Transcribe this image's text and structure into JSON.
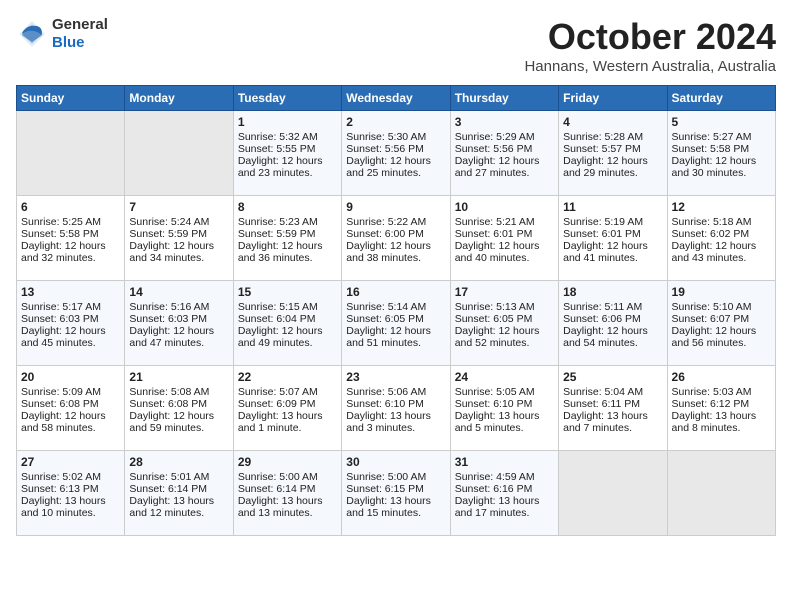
{
  "header": {
    "logo_line1": "General",
    "logo_line2": "Blue",
    "month_title": "October 2024",
    "location": "Hannans, Western Australia, Australia"
  },
  "weekdays": [
    "Sunday",
    "Monday",
    "Tuesday",
    "Wednesday",
    "Thursday",
    "Friday",
    "Saturday"
  ],
  "weeks": [
    [
      {
        "day": "",
        "info": ""
      },
      {
        "day": "",
        "info": ""
      },
      {
        "day": "1",
        "info": "Sunrise: 5:32 AM\nSunset: 5:55 PM\nDaylight: 12 hours and 23 minutes."
      },
      {
        "day": "2",
        "info": "Sunrise: 5:30 AM\nSunset: 5:56 PM\nDaylight: 12 hours and 25 minutes."
      },
      {
        "day": "3",
        "info": "Sunrise: 5:29 AM\nSunset: 5:56 PM\nDaylight: 12 hours and 27 minutes."
      },
      {
        "day": "4",
        "info": "Sunrise: 5:28 AM\nSunset: 5:57 PM\nDaylight: 12 hours and 29 minutes."
      },
      {
        "day": "5",
        "info": "Sunrise: 5:27 AM\nSunset: 5:58 PM\nDaylight: 12 hours and 30 minutes."
      }
    ],
    [
      {
        "day": "6",
        "info": "Sunrise: 5:25 AM\nSunset: 5:58 PM\nDaylight: 12 hours and 32 minutes."
      },
      {
        "day": "7",
        "info": "Sunrise: 5:24 AM\nSunset: 5:59 PM\nDaylight: 12 hours and 34 minutes."
      },
      {
        "day": "8",
        "info": "Sunrise: 5:23 AM\nSunset: 5:59 PM\nDaylight: 12 hours and 36 minutes."
      },
      {
        "day": "9",
        "info": "Sunrise: 5:22 AM\nSunset: 6:00 PM\nDaylight: 12 hours and 38 minutes."
      },
      {
        "day": "10",
        "info": "Sunrise: 5:21 AM\nSunset: 6:01 PM\nDaylight: 12 hours and 40 minutes."
      },
      {
        "day": "11",
        "info": "Sunrise: 5:19 AM\nSunset: 6:01 PM\nDaylight: 12 hours and 41 minutes."
      },
      {
        "day": "12",
        "info": "Sunrise: 5:18 AM\nSunset: 6:02 PM\nDaylight: 12 hours and 43 minutes."
      }
    ],
    [
      {
        "day": "13",
        "info": "Sunrise: 5:17 AM\nSunset: 6:03 PM\nDaylight: 12 hours and 45 minutes."
      },
      {
        "day": "14",
        "info": "Sunrise: 5:16 AM\nSunset: 6:03 PM\nDaylight: 12 hours and 47 minutes."
      },
      {
        "day": "15",
        "info": "Sunrise: 5:15 AM\nSunset: 6:04 PM\nDaylight: 12 hours and 49 minutes."
      },
      {
        "day": "16",
        "info": "Sunrise: 5:14 AM\nSunset: 6:05 PM\nDaylight: 12 hours and 51 minutes."
      },
      {
        "day": "17",
        "info": "Sunrise: 5:13 AM\nSunset: 6:05 PM\nDaylight: 12 hours and 52 minutes."
      },
      {
        "day": "18",
        "info": "Sunrise: 5:11 AM\nSunset: 6:06 PM\nDaylight: 12 hours and 54 minutes."
      },
      {
        "day": "19",
        "info": "Sunrise: 5:10 AM\nSunset: 6:07 PM\nDaylight: 12 hours and 56 minutes."
      }
    ],
    [
      {
        "day": "20",
        "info": "Sunrise: 5:09 AM\nSunset: 6:08 PM\nDaylight: 12 hours and 58 minutes."
      },
      {
        "day": "21",
        "info": "Sunrise: 5:08 AM\nSunset: 6:08 PM\nDaylight: 12 hours and 59 minutes."
      },
      {
        "day": "22",
        "info": "Sunrise: 5:07 AM\nSunset: 6:09 PM\nDaylight: 13 hours and 1 minute."
      },
      {
        "day": "23",
        "info": "Sunrise: 5:06 AM\nSunset: 6:10 PM\nDaylight: 13 hours and 3 minutes."
      },
      {
        "day": "24",
        "info": "Sunrise: 5:05 AM\nSunset: 6:10 PM\nDaylight: 13 hours and 5 minutes."
      },
      {
        "day": "25",
        "info": "Sunrise: 5:04 AM\nSunset: 6:11 PM\nDaylight: 13 hours and 7 minutes."
      },
      {
        "day": "26",
        "info": "Sunrise: 5:03 AM\nSunset: 6:12 PM\nDaylight: 13 hours and 8 minutes."
      }
    ],
    [
      {
        "day": "27",
        "info": "Sunrise: 5:02 AM\nSunset: 6:13 PM\nDaylight: 13 hours and 10 minutes."
      },
      {
        "day": "28",
        "info": "Sunrise: 5:01 AM\nSunset: 6:14 PM\nDaylight: 13 hours and 12 minutes."
      },
      {
        "day": "29",
        "info": "Sunrise: 5:00 AM\nSunset: 6:14 PM\nDaylight: 13 hours and 13 minutes."
      },
      {
        "day": "30",
        "info": "Sunrise: 5:00 AM\nSunset: 6:15 PM\nDaylight: 13 hours and 15 minutes."
      },
      {
        "day": "31",
        "info": "Sunrise: 4:59 AM\nSunset: 6:16 PM\nDaylight: 13 hours and 17 minutes."
      },
      {
        "day": "",
        "info": ""
      },
      {
        "day": "",
        "info": ""
      }
    ]
  ]
}
